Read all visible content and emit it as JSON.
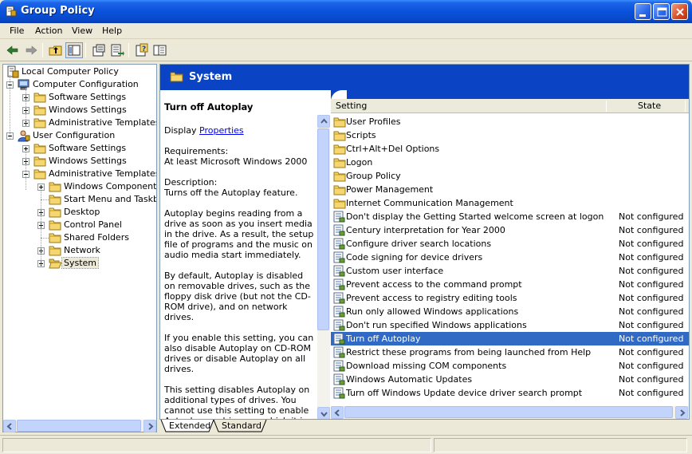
{
  "window": {
    "title": "Group Policy"
  },
  "menu": [
    "File",
    "Action",
    "View",
    "Help"
  ],
  "toolbar": {
    "icons": [
      "back-arrow-icon",
      "forward-arrow-icon",
      "up-folder-icon",
      "show-hide-tree-icon",
      "properties-icon",
      "export-list-icon",
      "help-icon",
      "show-hide-description-icon"
    ]
  },
  "tree": [
    {
      "label": "Local Computer Policy",
      "level": 0,
      "icon": "policy-icon",
      "expander": "none"
    },
    {
      "label": "Computer Configuration",
      "level": 1,
      "icon": "computer-icon",
      "expander": "minus"
    },
    {
      "label": "Software Settings",
      "level": 2,
      "icon": "folder-icon",
      "expander": "plus"
    },
    {
      "label": "Windows Settings",
      "level": 2,
      "icon": "folder-icon",
      "expander": "plus"
    },
    {
      "label": "Administrative Templates",
      "level": 2,
      "icon": "folder-icon",
      "expander": "plus"
    },
    {
      "label": "User Configuration",
      "level": 1,
      "icon": "user-icon",
      "expander": "minus"
    },
    {
      "label": "Software Settings",
      "level": 2,
      "icon": "folder-icon",
      "expander": "plus"
    },
    {
      "label": "Windows Settings",
      "level": 2,
      "icon": "folder-icon",
      "expander": "plus"
    },
    {
      "label": "Administrative Templates",
      "level": 2,
      "icon": "folder-icon",
      "expander": "minus"
    },
    {
      "label": "Windows Components",
      "level": 3,
      "icon": "folder-icon",
      "expander": "plus"
    },
    {
      "label": "Start Menu and Taskbar",
      "level": 3,
      "icon": "folder-icon",
      "expander": "none"
    },
    {
      "label": "Desktop",
      "level": 3,
      "icon": "folder-icon",
      "expander": "plus"
    },
    {
      "label": "Control Panel",
      "level": 3,
      "icon": "folder-icon",
      "expander": "plus"
    },
    {
      "label": "Shared Folders",
      "level": 3,
      "icon": "folder-icon",
      "expander": "none"
    },
    {
      "label": "Network",
      "level": 3,
      "icon": "folder-icon",
      "expander": "plus"
    },
    {
      "label": "System",
      "level": 3,
      "icon": "open-folder-icon",
      "expander": "plus",
      "selected": true
    }
  ],
  "banner": {
    "title": "System"
  },
  "description": {
    "heading": "Turn off Autoplay",
    "display_prefix": "Display ",
    "display_link": "Properties",
    "requirements_label": "Requirements:",
    "requirements_value": "At least Microsoft Windows 2000",
    "description_label": "Description:",
    "description_value": "Turns off the Autoplay feature.",
    "paragraphs": [
      "Autoplay begins reading from a drive as soon as you insert media in the drive. As a result, the setup file of programs and the music on audio media start immediately.",
      "By default, Autoplay is disabled on removable drives, such as the floppy disk drive (but not the CD-ROM drive), and on network drives.",
      "If you enable this setting, you can also disable Autoplay on CD-ROM drives or disable Autoplay on all drives.",
      "This setting disables Autoplay on additional types of drives. You cannot use this setting to enable Autoplay on drives on which it is disabled by default."
    ]
  },
  "list": {
    "headers": {
      "setting": "Setting",
      "state": "State"
    },
    "rows": [
      {
        "name": "User Profiles",
        "state": "",
        "icon": "folder-icon"
      },
      {
        "name": "Scripts",
        "state": "",
        "icon": "folder-icon"
      },
      {
        "name": "Ctrl+Alt+Del Options",
        "state": "",
        "icon": "folder-icon"
      },
      {
        "name": "Logon",
        "state": "",
        "icon": "folder-icon"
      },
      {
        "name": "Group Policy",
        "state": "",
        "icon": "folder-icon"
      },
      {
        "name": "Power Management",
        "state": "",
        "icon": "folder-icon"
      },
      {
        "name": "Internet Communication Management",
        "state": "",
        "icon": "folder-icon"
      },
      {
        "name": "Don't display the Getting Started welcome screen at logon",
        "state": "Not configured",
        "icon": "setting-icon"
      },
      {
        "name": "Century interpretation for Year 2000",
        "state": "Not configured",
        "icon": "setting-icon"
      },
      {
        "name": "Configure driver search locations",
        "state": "Not configured",
        "icon": "setting-icon"
      },
      {
        "name": "Code signing for device drivers",
        "state": "Not configured",
        "icon": "setting-icon"
      },
      {
        "name": "Custom user interface",
        "state": "Not configured",
        "icon": "setting-icon"
      },
      {
        "name": "Prevent access to the command prompt",
        "state": "Not configured",
        "icon": "setting-icon"
      },
      {
        "name": "Prevent access to registry editing tools",
        "state": "Not configured",
        "icon": "setting-icon"
      },
      {
        "name": "Run only allowed Windows applications",
        "state": "Not configured",
        "icon": "setting-icon"
      },
      {
        "name": "Don't run specified Windows applications",
        "state": "Not configured",
        "icon": "setting-icon"
      },
      {
        "name": "Turn off Autoplay",
        "state": "Not configured",
        "icon": "setting-icon",
        "selected": true
      },
      {
        "name": "Restrict these programs from being launched from Help",
        "state": "Not configured",
        "icon": "setting-icon"
      },
      {
        "name": "Download missing COM components",
        "state": "Not configured",
        "icon": "setting-icon"
      },
      {
        "name": "Windows Automatic Updates",
        "state": "Not configured",
        "icon": "setting-icon"
      },
      {
        "name": "Turn off Windows Update device driver search prompt",
        "state": "Not configured",
        "icon": "setting-icon"
      }
    ]
  },
  "tabs": [
    "Extended",
    "Standard"
  ],
  "colors": {
    "titlebar": "#0a52dc",
    "banner": "#0a44c4",
    "selection": "#316ac5",
    "link": "#0000ee"
  }
}
